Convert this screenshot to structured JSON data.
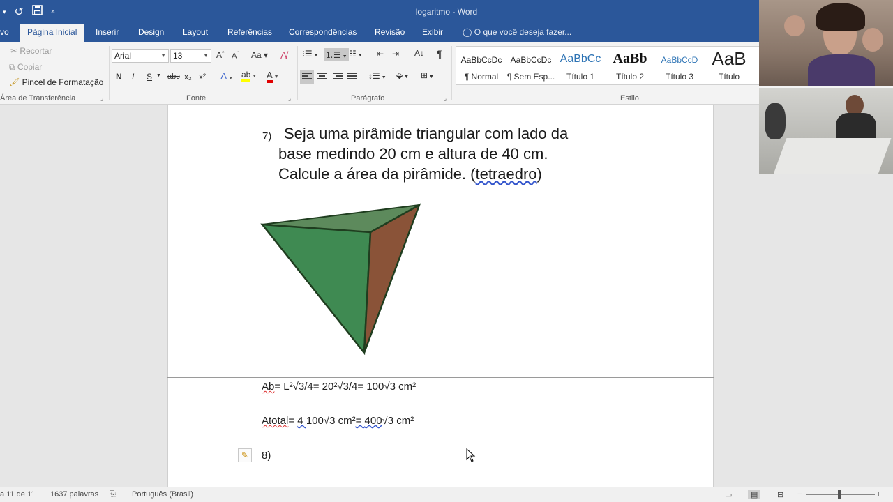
{
  "window": {
    "title": "logaritmo - Word"
  },
  "tabs": {
    "file_partial": "vo",
    "items": [
      "Página Inicial",
      "Inserir",
      "Design",
      "Layout",
      "Referências",
      "Correspondências",
      "Revisão",
      "Exibir"
    ],
    "active": "Página Inicial",
    "tell_me": "O que você deseja fazer..."
  },
  "ribbon": {
    "clipboard": {
      "cut": "Recortar",
      "copy": "Copiar",
      "format_painter": "Pincel de Formatação",
      "label": "Área de Transferência"
    },
    "font": {
      "family": "Arial",
      "size": "13",
      "label": "Fonte",
      "bold": "N",
      "italic": "I",
      "underline": "S",
      "strike": "abc",
      "subscript": "x₂",
      "superscript": "x²"
    },
    "paragraph": {
      "label": "Parágrafo"
    },
    "styles": {
      "label": "Estilo",
      "items": [
        {
          "preview": "AaBbCcDc",
          "name": "¶ Normal"
        },
        {
          "preview": "AaBbCcDc",
          "name": "¶ Sem Esp..."
        },
        {
          "preview": "AaBbCc",
          "name": "Título 1"
        },
        {
          "preview": "AaBb",
          "name": "Título 2"
        },
        {
          "preview": "AaBbCcD",
          "name": "Título 3"
        },
        {
          "preview": "AaB",
          "name": "Título"
        }
      ]
    }
  },
  "document": {
    "question_number": "7)",
    "question_lines": [
      "Seja uma pirâmide triangular com lado da",
      "base medindo 20 cm e altura de 40 cm.",
      "Calcule a área da pirâmide. ("
    ],
    "question_tail_word": "tetraedro",
    "question_tail_close": ")",
    "figure_colors": {
      "left_face": "#3f8a52",
      "right_face": "#8a5338",
      "top_face": "#5d8a5c",
      "edge": "#1f3d1f"
    },
    "ab_label": "Ab",
    "ab_formula": "= L²√3/4= 20²√3/4= 100√3 cm²",
    "atotal_label": "Atotal",
    "atotal_eq": "= ",
    "atotal_four": "4 ",
    "atotal_mid": " 100√3 cm²",
    "atotal_eq2": "= ",
    "atotal_result": " 400",
    "atotal_tail": "√3 cm²",
    "next_question": "8)"
  },
  "statusbar": {
    "page": "a 11 de 11",
    "words": "1637 palavras",
    "language": "Português (Brasil)"
  },
  "colors": {
    "word_blue": "#2b579a"
  }
}
